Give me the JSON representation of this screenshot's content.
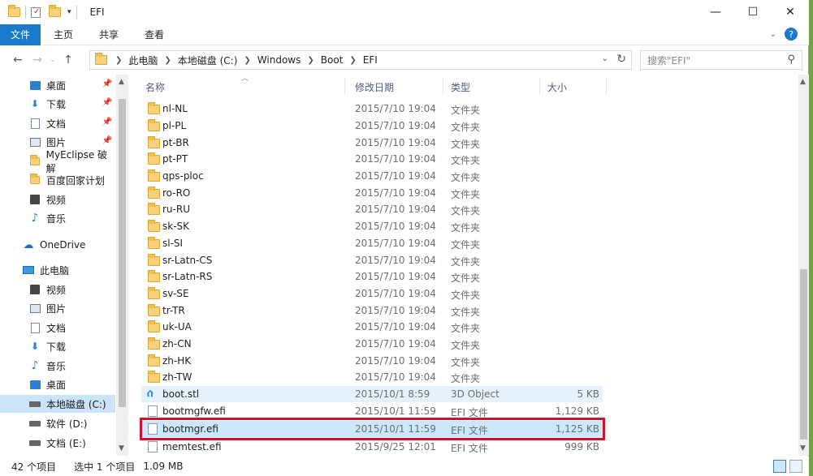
{
  "window": {
    "title": "EFI",
    "controls": {
      "minimize": "—",
      "maximize": "☐",
      "close": "✕"
    }
  },
  "ribbon": {
    "tabs": [
      "文件",
      "主页",
      "共享",
      "查看"
    ]
  },
  "nav": {
    "breadcrumbs": [
      "此电脑",
      "本地磁盘 (C:)",
      "Windows",
      "Boot",
      "EFI"
    ],
    "search_placeholder": "搜索\"EFI\""
  },
  "sidebar": {
    "items": [
      {
        "label": "桌面",
        "icon": "desktop-icon",
        "pinned": true
      },
      {
        "label": "下载",
        "icon": "download-icon",
        "pinned": true
      },
      {
        "label": "文档",
        "icon": "document-icon",
        "pinned": true
      },
      {
        "label": "图片",
        "icon": "picture-icon",
        "pinned": true
      },
      {
        "label": "MyEclipse 破解",
        "icon": "folder-icon",
        "pinned": false
      },
      {
        "label": "百度回家计划",
        "icon": "folder-icon",
        "pinned": false
      },
      {
        "label": "视频",
        "icon": "video-icon",
        "pinned": false
      },
      {
        "label": "音乐",
        "icon": "music-icon",
        "pinned": false
      },
      {
        "label": "OneDrive",
        "icon": "cloud-icon",
        "pinned": false
      },
      {
        "label": "此电脑",
        "icon": "computer-icon",
        "pinned": false
      },
      {
        "label": "视频",
        "icon": "video-icon",
        "pinned": false
      },
      {
        "label": "图片",
        "icon": "picture-icon",
        "pinned": false
      },
      {
        "label": "文档",
        "icon": "document-icon",
        "pinned": false
      },
      {
        "label": "下载",
        "icon": "download-icon",
        "pinned": false
      },
      {
        "label": "音乐",
        "icon": "music-icon",
        "pinned": false
      },
      {
        "label": "桌面",
        "icon": "desktop-icon",
        "pinned": false
      },
      {
        "label": "本地磁盘 (C:)",
        "icon": "drive-icon",
        "pinned": false,
        "selected": true
      },
      {
        "label": "软件 (D:)",
        "icon": "drive-icon",
        "pinned": false
      },
      {
        "label": "文档 (E:)",
        "icon": "drive-icon",
        "pinned": false
      }
    ]
  },
  "columns": {
    "name": "名称",
    "date": "修改日期",
    "type": "类型",
    "size": "大小"
  },
  "files": [
    {
      "name": "nl-NL",
      "date": "2015/7/10 19:04",
      "type": "文件夹",
      "size": "",
      "kind": "folder"
    },
    {
      "name": "pl-PL",
      "date": "2015/7/10 19:04",
      "type": "文件夹",
      "size": "",
      "kind": "folder"
    },
    {
      "name": "pt-BR",
      "date": "2015/7/10 19:04",
      "type": "文件夹",
      "size": "",
      "kind": "folder"
    },
    {
      "name": "pt-PT",
      "date": "2015/7/10 19:04",
      "type": "文件夹",
      "size": "",
      "kind": "folder"
    },
    {
      "name": "qps-ploc",
      "date": "2015/7/10 19:04",
      "type": "文件夹",
      "size": "",
      "kind": "folder"
    },
    {
      "name": "ro-RO",
      "date": "2015/7/10 19:04",
      "type": "文件夹",
      "size": "",
      "kind": "folder"
    },
    {
      "name": "ru-RU",
      "date": "2015/7/10 19:04",
      "type": "文件夹",
      "size": "",
      "kind": "folder"
    },
    {
      "name": "sk-SK",
      "date": "2015/7/10 19:04",
      "type": "文件夹",
      "size": "",
      "kind": "folder"
    },
    {
      "name": "sl-SI",
      "date": "2015/7/10 19:04",
      "type": "文件夹",
      "size": "",
      "kind": "folder"
    },
    {
      "name": "sr-Latn-CS",
      "date": "2015/7/10 19:04",
      "type": "文件夹",
      "size": "",
      "kind": "folder"
    },
    {
      "name": "sr-Latn-RS",
      "date": "2015/7/10 19:04",
      "type": "文件夹",
      "size": "",
      "kind": "folder"
    },
    {
      "name": "sv-SE",
      "date": "2015/7/10 19:04",
      "type": "文件夹",
      "size": "",
      "kind": "folder"
    },
    {
      "name": "tr-TR",
      "date": "2015/7/10 19:04",
      "type": "文件夹",
      "size": "",
      "kind": "folder"
    },
    {
      "name": "uk-UA",
      "date": "2015/7/10 19:04",
      "type": "文件夹",
      "size": "",
      "kind": "folder"
    },
    {
      "name": "zh-CN",
      "date": "2015/7/10 19:04",
      "type": "文件夹",
      "size": "",
      "kind": "folder"
    },
    {
      "name": "zh-HK",
      "date": "2015/7/10 19:04",
      "type": "文件夹",
      "size": "",
      "kind": "folder"
    },
    {
      "name": "zh-TW",
      "date": "2015/7/10 19:04",
      "type": "文件夹",
      "size": "",
      "kind": "folder"
    },
    {
      "name": "boot.stl",
      "date": "2015/10/1 8:59",
      "type": "3D Object",
      "size": "5 KB",
      "kind": "stl",
      "highlight": true
    },
    {
      "name": "bootmgfw.efi",
      "date": "2015/10/1 11:59",
      "type": "EFI 文件",
      "size": "1,129 KB",
      "kind": "file"
    },
    {
      "name": "bootmgr.efi",
      "date": "2015/10/1 11:59",
      "type": "EFI 文件",
      "size": "1,125 KB",
      "kind": "file",
      "selected": true
    },
    {
      "name": "memtest.efi",
      "date": "2015/9/25 12:01",
      "type": "EFI 文件",
      "size": "999 KB",
      "kind": "file"
    }
  ],
  "status": {
    "count": "42 个项目",
    "selected": "选中 1 个项目",
    "size": "1.09 MB"
  },
  "colors": {
    "accent": "#1979ca",
    "selection": "#cce8ff",
    "marker": "#d2112f"
  }
}
